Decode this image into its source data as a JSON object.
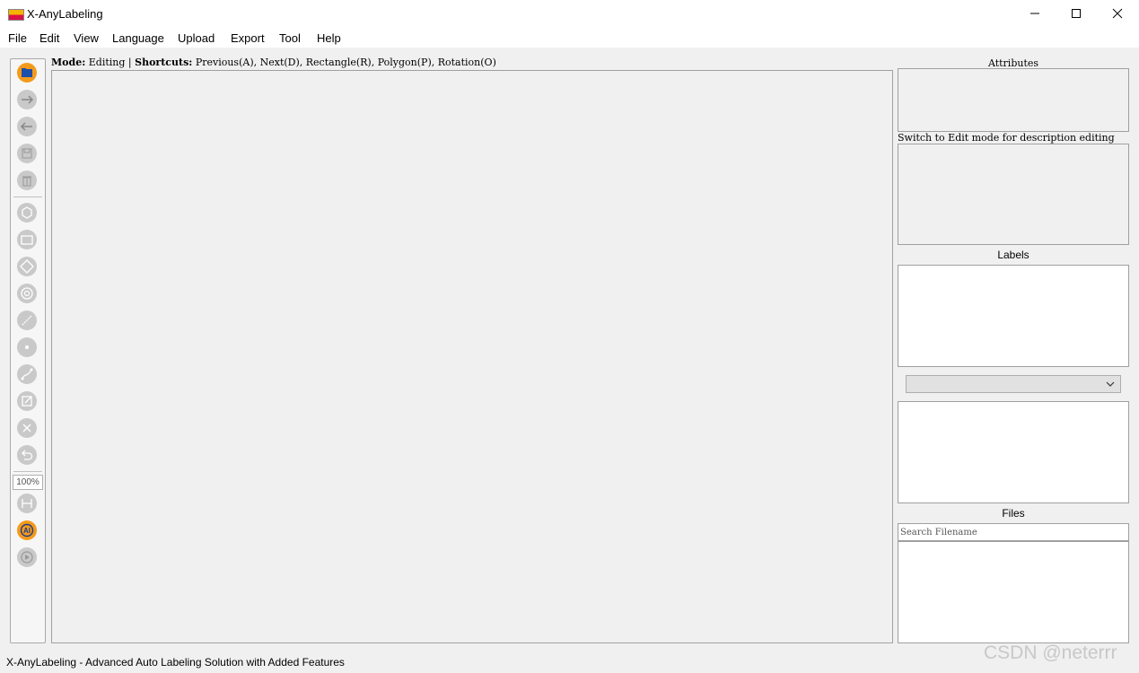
{
  "window": {
    "title": "X-AnyLabeling",
    "app_icon": "x-anylabeling-logo-icon",
    "controls": [
      "minimize-icon",
      "maximize-icon",
      "close-icon"
    ]
  },
  "menu": [
    "File",
    "Edit",
    "View",
    "Language",
    "Upload",
    "Export",
    "Tool",
    "Help"
  ],
  "toolbar": {
    "tools": [
      {
        "name": "open-folder",
        "icon": "folder-open-icon",
        "active": true
      },
      {
        "name": "next-image",
        "icon": "arrow-right-icon"
      },
      {
        "name": "previous-image",
        "icon": "arrow-left-icon"
      },
      {
        "name": "save",
        "icon": "save-icon"
      },
      {
        "name": "delete-file",
        "icon": "trash-icon"
      },
      {
        "name": "create-polygon",
        "icon": "polygon-icon"
      },
      {
        "name": "create-rectangle",
        "icon": "rectangle-icon"
      },
      {
        "name": "create-rotation",
        "icon": "rotation-diamond-icon"
      },
      {
        "name": "create-circle",
        "icon": "circle-icon"
      },
      {
        "name": "create-line",
        "icon": "line-icon"
      },
      {
        "name": "create-point",
        "icon": "point-icon"
      },
      {
        "name": "create-linestrip",
        "icon": "linestrip-icon"
      },
      {
        "name": "edit-polygon",
        "icon": "edit-icon"
      },
      {
        "name": "delete-polygon",
        "icon": "delete-x-icon"
      },
      {
        "name": "undo",
        "icon": "undo-icon"
      },
      {
        "name": "fit-width",
        "icon": "fit-width-icon"
      },
      {
        "name": "auto-labeling",
        "icon": "ai-icon",
        "active": true
      },
      {
        "name": "run-all",
        "icon": "play-icon"
      }
    ],
    "zoom": "100%"
  },
  "mode_line": {
    "mode_label": "Mode:",
    "mode_value": "Editing",
    "shortcuts_label": "Shortcuts:",
    "shortcuts_value": "Previous(A), Next(D), Rectangle(R), Polygon(P), Rotation(O)"
  },
  "right_panel": {
    "attributes_title": "Attributes",
    "description_hint": "Switch to Edit mode for description editing",
    "labels_title": "Labels",
    "files_title": "Files",
    "search_placeholder": "Search Filename"
  },
  "status_bar": "X-AnyLabeling - Advanced Auto Labeling Solution with Added Features",
  "watermark": "CSDN @neterrr",
  "colors": {
    "active_tool": "#f39a1b",
    "inactive_tool": "#c9c9c9",
    "background": "#f0f0f0"
  }
}
